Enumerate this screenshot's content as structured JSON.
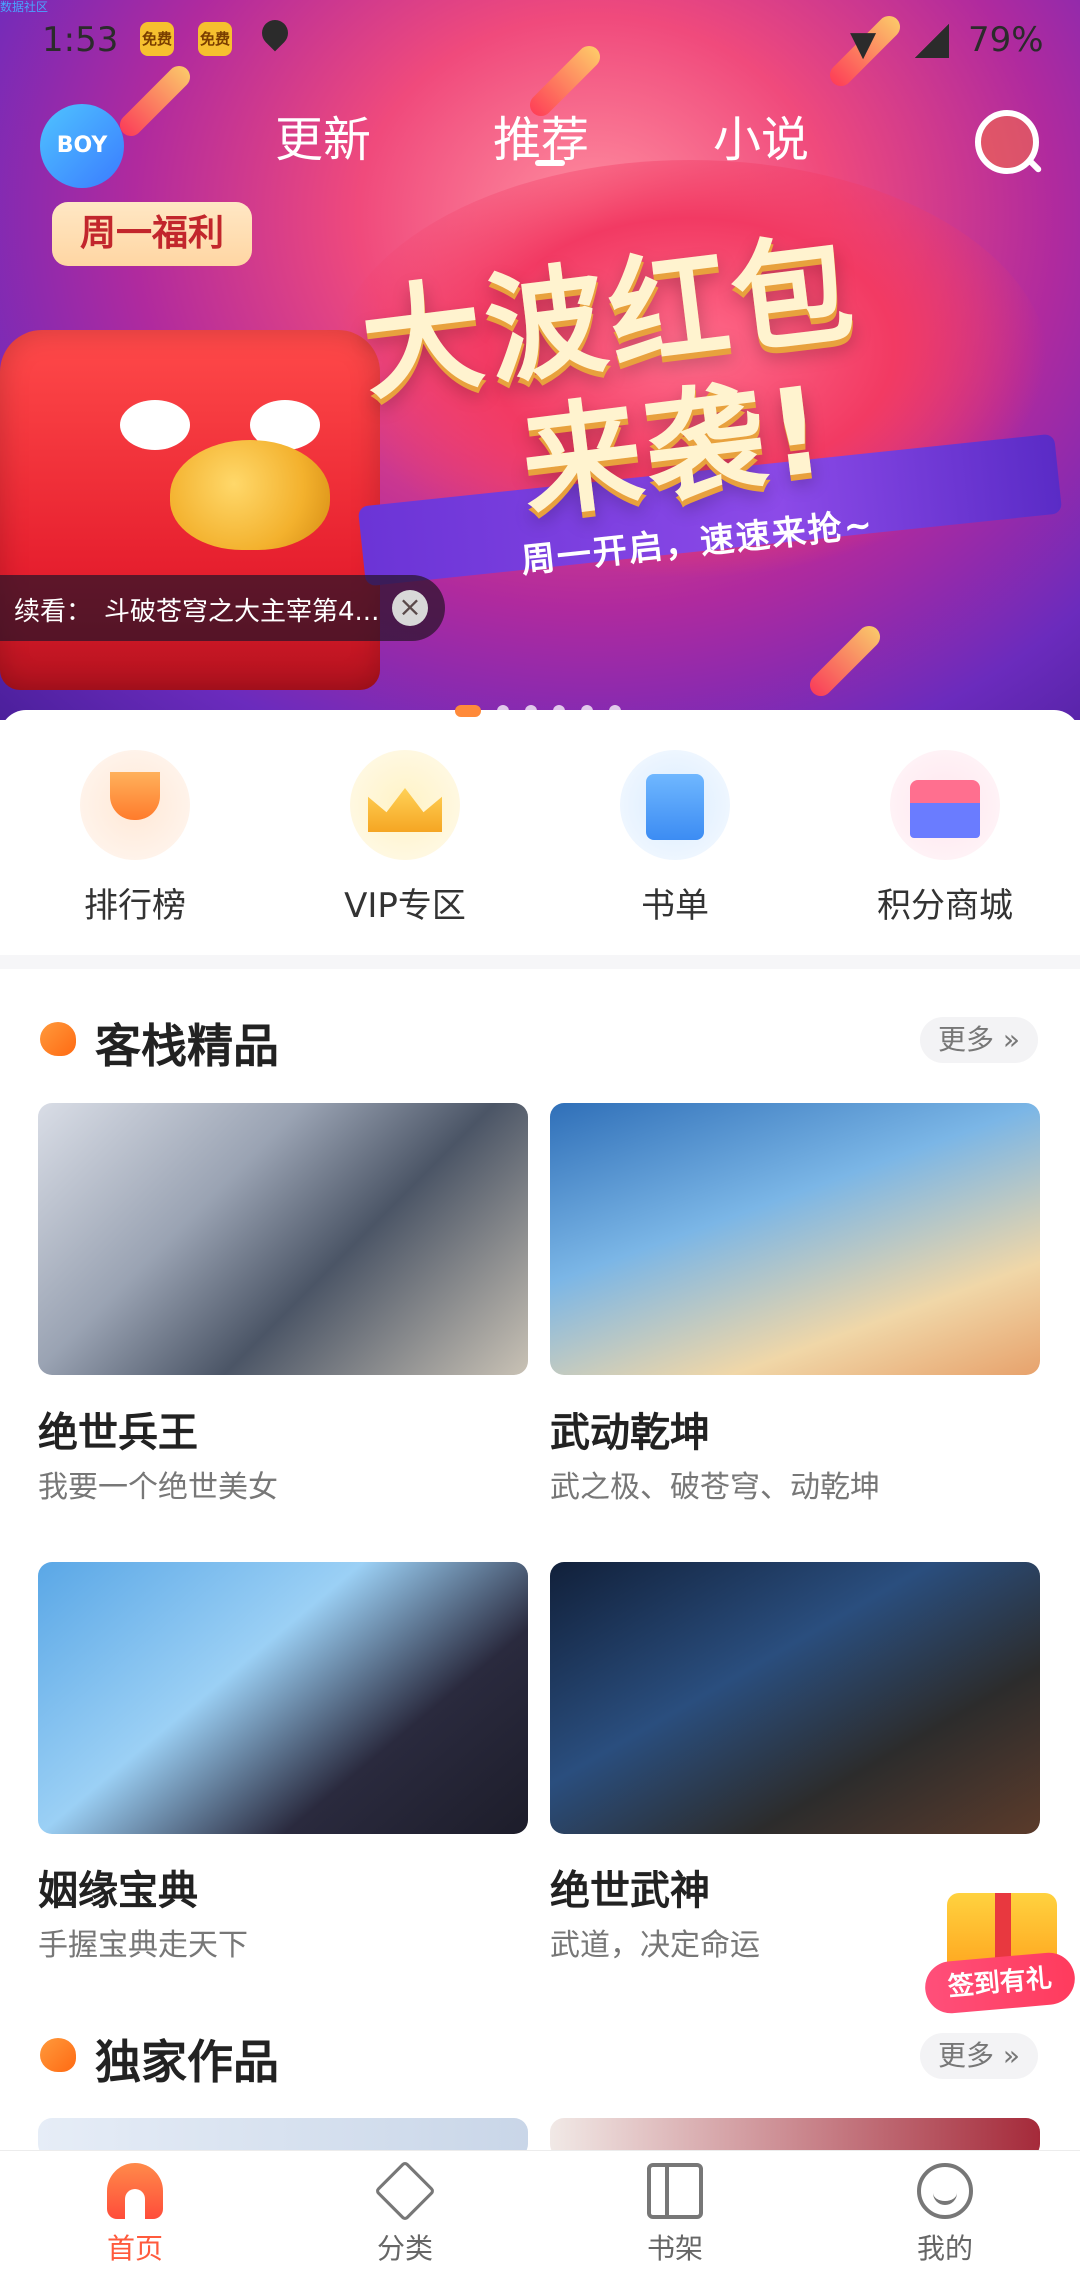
{
  "top_label": "数据社区",
  "status_bar": {
    "time": "1:53",
    "badge1": "免费",
    "badge2": "免费",
    "battery": "79%"
  },
  "top_nav": {
    "avatar_text": "BOY",
    "tabs": [
      {
        "label": "更新"
      },
      {
        "label": "推荐"
      },
      {
        "label": "小说"
      }
    ],
    "active_tab": "推荐"
  },
  "banner": {
    "tag": "周一福利",
    "headline_line1": "大波红包",
    "headline_line2": "来袭!",
    "ribbon_text": "周一开启，速速来抢~",
    "slides_count": 6,
    "active_slide": 1
  },
  "continue_reading": {
    "label": "续看：",
    "title": "斗破苍穹之大主宰第4..."
  },
  "quick_entries": [
    {
      "label": "排行榜",
      "icon": "trophy-icon"
    },
    {
      "label": "VIP专区",
      "icon": "crown-icon"
    },
    {
      "label": "书单",
      "icon": "book-icon"
    },
    {
      "label": "积分商城",
      "icon": "shop-icon"
    }
  ],
  "sections": [
    {
      "title": "客栈精品",
      "more": "更多",
      "items": [
        {
          "title": "绝世兵王",
          "subtitle": "我要一个绝世美女"
        },
        {
          "title": "武动乾坤",
          "subtitle": "武之极、破苍穹、动乾坤"
        },
        {
          "title": "姻缘宝典",
          "subtitle": "手握宝典走天下"
        },
        {
          "title": "绝世武神",
          "subtitle": "武道，决定命运"
        }
      ]
    },
    {
      "title": "独家作品",
      "more": "更多"
    }
  ],
  "floating_gift": {
    "label": "签到有礼"
  },
  "bottom_nav": [
    {
      "label": "首页",
      "icon": "home-icon",
      "active": true
    },
    {
      "label": "分类",
      "icon": "category-icon",
      "active": false
    },
    {
      "label": "书架",
      "icon": "bookshelf-icon",
      "active": false
    },
    {
      "label": "我的",
      "icon": "profile-icon",
      "active": false
    }
  ],
  "colors": {
    "accent": "#ff5a3c",
    "section_icon": "#ff7a1f"
  }
}
